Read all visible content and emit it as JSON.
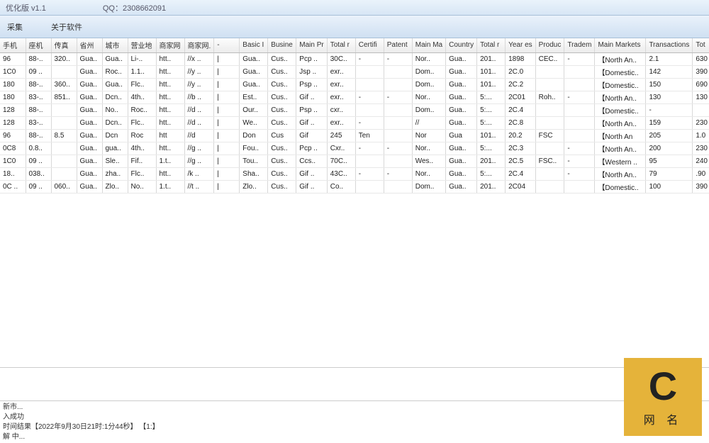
{
  "titlebar": {
    "title": "优化版 v1.1",
    "qq_label": "QQ：2308662091"
  },
  "menubar": {
    "collect": "采集",
    "about": "关于软件"
  },
  "columns": [
    "手机",
    "座机",
    "传真",
    "省州",
    "城市",
    "营业地",
    "商家网",
    "商家网.",
    "-",
    "Basic I",
    "Busine",
    "Main Pr",
    "Total r",
    "Certifi",
    "Patent",
    "Main Ma",
    "Country",
    "Total r",
    "Year es",
    "Produc",
    "Tradem",
    "Main Markets",
    "Transactions",
    "Tot"
  ],
  "rows": [
    {
      "c": [
        "96",
        "88-..",
        "320..",
        "Gua..",
        "Gua..",
        "Li-..",
        "htt..",
        "//x ..",
        "|",
        "Gua..",
        "Cus..",
        "Pcp ..",
        "30C..",
        "-",
        "-",
        "Nor..",
        "Gua..",
        "201..",
        "1898",
        "CEC..",
        "-",
        "【North An..",
        "2.1",
        "630"
      ]
    },
    {
      "c": [
        "1C0",
        "09 ..",
        "",
        "Gua..",
        "Roc..",
        "1.1..",
        "htt..",
        "//y ..",
        "|",
        "Gua..",
        "Cus..",
        "Jsp ..",
        "exr..",
        "",
        "",
        "Dom..",
        "Gua..",
        "101..",
        "2C.0",
        "",
        "",
        "【Domestic..",
        "142",
        "390"
      ]
    },
    {
      "c": [
        "180",
        "88-..",
        "360..",
        "Gua..",
        "Gua..",
        "Flc..",
        "htt..",
        "//y ..",
        "|",
        "Gua..",
        "Cus..",
        "Psp ..",
        "exr..",
        "",
        "",
        "Dom..",
        "Gua..",
        "101..",
        "2C.2",
        "",
        "",
        "【Domestic..",
        "150",
        "690"
      ]
    },
    {
      "c": [
        "180",
        "83-..",
        "851..",
        "Gua..",
        "Dcn..",
        "4th..",
        "htt..",
        "//b ..",
        "|",
        "Est..",
        "Cus..",
        "Gif ..",
        "exr..",
        "-",
        "-",
        "Nor..",
        "Gua..",
        "5:...",
        "2C01",
        "Roh..",
        "-",
        "【North An..",
        "130",
        "130"
      ]
    },
    {
      "c": [
        "128",
        "88-..",
        "",
        "Gua..",
        "No..",
        "Roc..",
        "htt..",
        "//d ..",
        "|",
        "Our..",
        "Cus..",
        "Psp ..",
        "cxr..",
        "",
        "",
        "Dom..",
        "Gua..",
        "5:...",
        "2C.4",
        "",
        "",
        "【Domestic..",
        "-",
        ""
      ]
    },
    {
      "c": [
        "128",
        "83-..",
        "",
        "Gua..",
        "Dcn..",
        "Flc..",
        "htt..",
        "//d ..",
        "|",
        "We..",
        "Cus..",
        "Gif ..",
        "exr..",
        "-",
        "",
        "//",
        "Gua..",
        "5:...",
        "2C.8",
        "",
        "",
        "【North An..",
        "159",
        "230"
      ]
    },
    {
      "c": [
        "96",
        "88-..",
        "8.5",
        "Gua..",
        "Dcn",
        "Roc",
        "htt",
        "//d",
        "|",
        "Don",
        "Cus",
        "Gif",
        "245",
        "Ten",
        "",
        "Nor",
        "Gua",
        "101..",
        "20.2",
        "FSC",
        "",
        "【North An",
        "205",
        "1.0"
      ]
    },
    {
      "c": [
        "0C8",
        "0.8..",
        "",
        "Gua..",
        "gua..",
        "4th..",
        "htt..",
        "//g ..",
        "|",
        "Fou..",
        "Cus..",
        "Pcp ..",
        "Cxr..",
        "-",
        "-",
        "Nor..",
        "Gua..",
        "5:...",
        "2C.3",
        "",
        "-",
        "【North An..",
        "200",
        "230"
      ]
    },
    {
      "c": [
        "1C0",
        "09 ..",
        "",
        "Gua..",
        "Sle..",
        "Fif..",
        "1.t..",
        "//g ..",
        "|",
        "Tou..",
        "Cus..",
        "Ccs..",
        "70C..",
        "",
        "",
        "Wes..",
        "Gua..",
        "201..",
        "2C.5",
        "FSC..",
        "-",
        "【Western ..",
        "95",
        "240"
      ]
    },
    {
      "c": [
        "18..",
        "038..",
        "",
        "Gua..",
        "zha..",
        "Flc..",
        "htt..",
        "/k ..",
        "|",
        "Sha..",
        "Cus..",
        "Gif ..",
        "43C..",
        "-",
        "-",
        "Nor..",
        "Gua..",
        "5:...",
        "2C.4",
        "",
        "-",
        "【North An..",
        "79",
        ".90"
      ]
    },
    {
      "c": [
        "0C ..",
        "09 ..",
        "060..",
        "Gua..",
        "Zlo..",
        "No..",
        "1.t..",
        "//t ..",
        "|",
        "Zlo..",
        "Cus..",
        "Gif ..",
        "Co..",
        "",
        "",
        "Dom..",
        "Gua..",
        "201..",
        "2C04",
        "",
        "",
        "【Domestic..",
        "100",
        "390"
      ]
    }
  ],
  "status": {
    "l1": "新市...",
    "l2": "入成功",
    "l3": "时间结果【2022年9月30日21时:1分44秒】 【1:】",
    "l4": "解 中..."
  },
  "logo": {
    "text": "网 名"
  }
}
